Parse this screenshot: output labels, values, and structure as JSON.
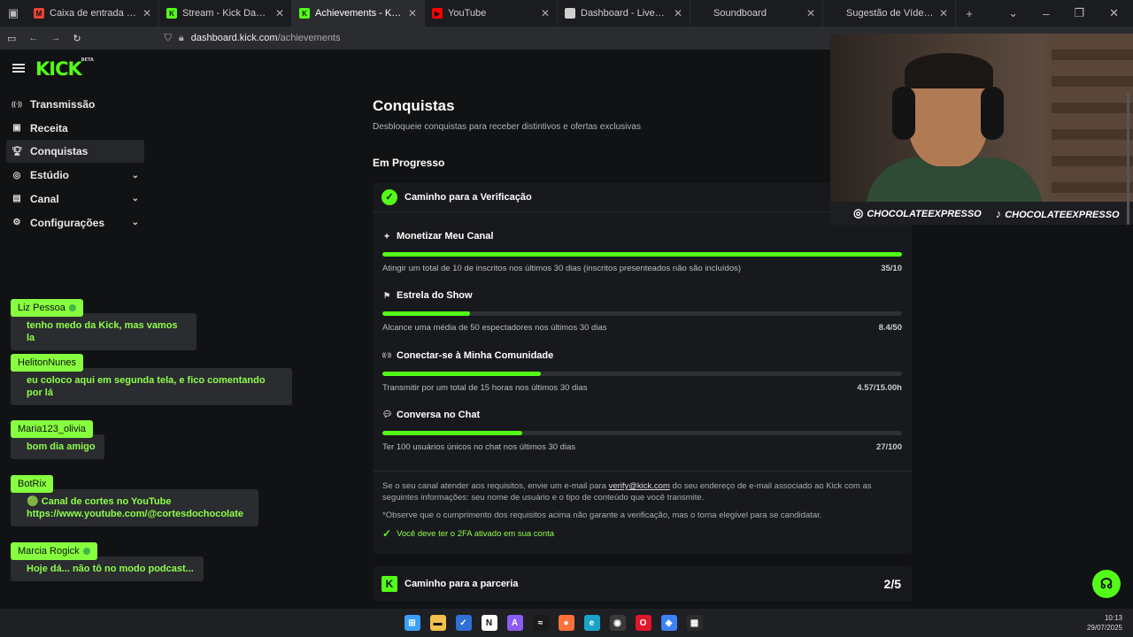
{
  "browser": {
    "tabs": [
      {
        "title": "Caixa de entrada - hudsonfabio",
        "favicon": "gmail-icon",
        "color": "#ea4335",
        "active": false
      },
      {
        "title": "Stream - Kick Dashboard",
        "favicon": "kick-icon",
        "color": "#53fc18",
        "active": false
      },
      {
        "title": "Achievements - Kick Dashboard",
        "favicon": "kick-icon",
        "color": "#53fc18",
        "active": true
      },
      {
        "title": "YouTube",
        "favicon": "youtube-icon",
        "color": "#ff0000",
        "active": false
      },
      {
        "title": "Dashboard - LivePix",
        "favicon": "livepix-icon",
        "color": "#cfcfcf",
        "active": false
      },
      {
        "title": "Soundboard",
        "favicon": "",
        "color": "#1b1c1f",
        "active": false
      },
      {
        "title": "Sugestão de Vídeos",
        "favicon": "",
        "color": "#1b1c1f",
        "active": false
      }
    ],
    "url_host": "dashboard.kick.com",
    "url_path": "/achievements"
  },
  "sidebar": {
    "logo": "KICK",
    "logo_badge": "BETA",
    "items": [
      {
        "label": "Transmissão",
        "icon": "broadcast-icon",
        "active": false,
        "expandable": false
      },
      {
        "label": "Receita",
        "icon": "revenue-icon",
        "active": false,
        "expandable": false
      },
      {
        "label": "Conquistas",
        "icon": "trophy-icon",
        "active": true,
        "expandable": false
      },
      {
        "label": "Estúdio",
        "icon": "studio-icon",
        "active": false,
        "expandable": true
      },
      {
        "label": "Canal",
        "icon": "channel-icon",
        "active": false,
        "expandable": true
      },
      {
        "label": "Configurações",
        "icon": "gear-icon",
        "active": false,
        "expandable": true
      }
    ]
  },
  "chat": [
    {
      "user": "Liz Pessoa",
      "badge": true,
      "message": "tenho medo da Kick, mas vamos la"
    },
    {
      "user": "HelitonNunes",
      "badge": false,
      "message": "eu coloco aqui em segunda tela, e fico comentando por lá"
    },
    {
      "user": "Maria123_olivia",
      "badge": false,
      "message": "bom dia amigo"
    },
    {
      "user": "BotRix",
      "badge": false,
      "message": "🟢 Canal de cortes no YouTube https://www.youtube.com/@cortesdochocolate"
    },
    {
      "user": "Marcia Rogick",
      "badge": true,
      "message": "Hoje dá... não tô no modo podcast..."
    }
  ],
  "page": {
    "title": "Conquistas",
    "subtitle": "Desbloqueie conquistas para receber distintivos e ofertas exclusivas",
    "section": "Em Progresso"
  },
  "verification": {
    "title": "Caminho para a Verificação",
    "achievements": [
      {
        "title": "Monetizar Meu Canal",
        "icon": "sparkle-icon",
        "desc": "Atingir um total de 10 de inscritos nos últimos 30 dias (inscritos presenteados não são incluídos)",
        "value": "35/10",
        "progress": 1.0
      },
      {
        "title": "Estrela do Show",
        "icon": "star-person-icon",
        "desc": "Alcance uma média de 50 espectadores nos últimos 30 dias",
        "value": "8.4/50",
        "progress": 0.168
      },
      {
        "title": "Conectar-se à Minha Comunidade",
        "icon": "broadcast-icon",
        "desc": "Transmitir por um total de 15 horas nos últimos 30 dias",
        "value": "4.57/15.00h",
        "progress": 0.305
      },
      {
        "title": "Conversa no Chat",
        "icon": "chat-icon",
        "desc": "Ter 100 usuários únicos no chat nos últimos 30 dias",
        "value": "27/100",
        "progress": 0.27
      }
    ],
    "info_pre": "Se o seu canal atender aos requisitos, envie um e-mail para ",
    "info_link": "verify@kick.com",
    "info_post": " do seu endereço de e-mail associado ao Kick com as seguintes informações: seu nome de usuário e o tipo de conteúdo que você transmite.",
    "note": "*Observe que o cumprimento dos requisitos acima não garante a verificação, mas o torna elegível para se candidatar.",
    "requirement": "Você deve ter o 2FA ativado em sua conta"
  },
  "partner": {
    "title": "Caminho para a parceria",
    "count": "2/5"
  },
  "webcam": {
    "instagram": "CHOCOLATEEXPRESSO",
    "tiktok": "CHOCOLATEEXPRESSO"
  },
  "taskbar": {
    "time": "10:13",
    "date": "29/07/2025",
    "icons": [
      {
        "name": "windows-start-icon",
        "color": "#3aa0ff",
        "glyph": "⊞"
      },
      {
        "name": "file-explorer-icon",
        "color": "#f2c14e",
        "glyph": "▬"
      },
      {
        "name": "todo-icon",
        "color": "#2f6fd6",
        "glyph": "✓"
      },
      {
        "name": "notion-icon",
        "color": "#ffffff",
        "glyph": "N"
      },
      {
        "name": "affinity-icon",
        "color": "#8b5cf6",
        "glyph": "A"
      },
      {
        "name": "audio-app-icon",
        "color": "#1a1a1a",
        "glyph": "≈"
      },
      {
        "name": "firefox-icon",
        "color": "#ff7139",
        "glyph": "●"
      },
      {
        "name": "edge-icon",
        "color": "#1aa3c9",
        "glyph": "e"
      },
      {
        "name": "obs-icon",
        "color": "#3a3a3a",
        "glyph": "◉"
      },
      {
        "name": "opera-icon",
        "color": "#e0162b",
        "glyph": "O"
      },
      {
        "name": "dev-app-icon",
        "color": "#3b82f6",
        "glyph": "◆"
      },
      {
        "name": "calendar-icon",
        "color": "#2b2b2b",
        "glyph": "▦"
      }
    ]
  }
}
